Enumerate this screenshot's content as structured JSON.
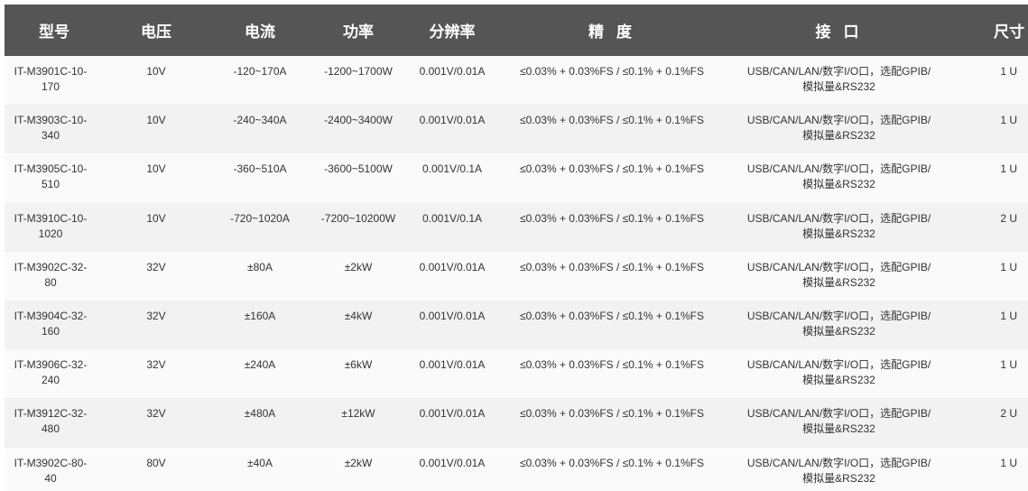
{
  "table": {
    "headers": {
      "model": "型号",
      "voltage": "电压",
      "current": "电流",
      "power": "功率",
      "resolution": "分辨率",
      "accuracy": "精 度",
      "interface": "接 口",
      "size": "尺寸"
    },
    "rows": [
      {
        "model": "IT-M3901C-10-170",
        "voltage": "10V",
        "current": "-120~170A",
        "power": "-1200~1700W",
        "resolution": "0.001V/0.01A",
        "accuracy": "≤0.03% + 0.03%FS / ≤0.1% + 0.1%FS",
        "interface": "USB/CAN/LAN/数字I/O口，选配GPIB/模拟量&RS232",
        "size": "1 U"
      },
      {
        "model": "IT-M3903C-10-340",
        "voltage": "10V",
        "current": "-240~340A",
        "power": "-2400~3400W",
        "resolution": "0.001V/0.01A",
        "accuracy": "≤0.03% + 0.03%FS / ≤0.1% + 0.1%FS",
        "interface": "USB/CAN/LAN/数字I/O口，选配GPIB/模拟量&RS232",
        "size": "1 U"
      },
      {
        "model": "IT-M3905C-10-510",
        "voltage": "10V",
        "current": "-360~510A",
        "power": "-3600~5100W",
        "resolution": "0.001V/0.1A",
        "accuracy": "≤0.03% + 0.03%FS / ≤0.1% + 0.1%FS",
        "interface": "USB/CAN/LAN/数字I/O口，选配GPIB/模拟量&RS232",
        "size": "1 U"
      },
      {
        "model": "IT-M3910C-10-1020",
        "voltage": "10V",
        "current": "-720~1020A",
        "power": "-7200~10200W",
        "resolution": "0.001V/0.1A",
        "accuracy": "≤0.03% + 0.03%FS / ≤0.1% + 0.1%FS",
        "interface": "USB/CAN/LAN/数字I/O口，选配GPIB/模拟量&RS232",
        "size": "2 U"
      },
      {
        "model": "IT-M3902C-32-80",
        "voltage": "32V",
        "current": "±80A",
        "power": "±2kW",
        "resolution": "0.001V/0.01A",
        "accuracy": "≤0.03% + 0.03%FS / ≤0.1% + 0.1%FS",
        "interface": "USB/CAN/LAN/数字I/O口，选配GPIB/模拟量&RS232",
        "size": "1 U"
      },
      {
        "model": "IT-M3904C-32-160",
        "voltage": "32V",
        "current": "±160A",
        "power": "±4kW",
        "resolution": "0.001V/0.01A",
        "accuracy": "≤0.03% + 0.03%FS / ≤0.1% + 0.1%FS",
        "interface": "USB/CAN/LAN/数字I/O口，选配GPIB/模拟量&RS232",
        "size": "1 U"
      },
      {
        "model": "IT-M3906C-32-240",
        "voltage": "32V",
        "current": "±240A",
        "power": "±6kW",
        "resolution": "0.001V/0.01A",
        "accuracy": "≤0.03% + 0.03%FS / ≤0.1% + 0.1%FS",
        "interface": "USB/CAN/LAN/数字I/O口，选配GPIB/模拟量&RS232",
        "size": "1 U"
      },
      {
        "model": "IT-M3912C-32-480",
        "voltage": "32V",
        "current": "±480A",
        "power": "±12kW",
        "resolution": "0.001V/0.01A",
        "accuracy": "≤0.03% + 0.03%FS / ≤0.1% + 0.1%FS",
        "interface": "USB/CAN/LAN/数字I/O口，选配GPIB/模拟量&RS232",
        "size": "2 U"
      },
      {
        "model": "IT-M3902C-80-40",
        "voltage": "80V",
        "current": "±40A",
        "power": "±2kW",
        "resolution": "0.001V/0.01A",
        "accuracy": "≤0.03% + 0.03%FS / ≤0.1% + 0.1%FS",
        "interface": "USB/CAN/LAN/数字I/O口，选配GPIB/模拟量&RS232",
        "size": "1 U"
      }
    ]
  },
  "colors": {
    "header_bg": "#555555",
    "header_text": "#ffffff",
    "row_odd": "#fafafa",
    "row_even": "#f2f2f2",
    "cell_text": "#333333"
  }
}
